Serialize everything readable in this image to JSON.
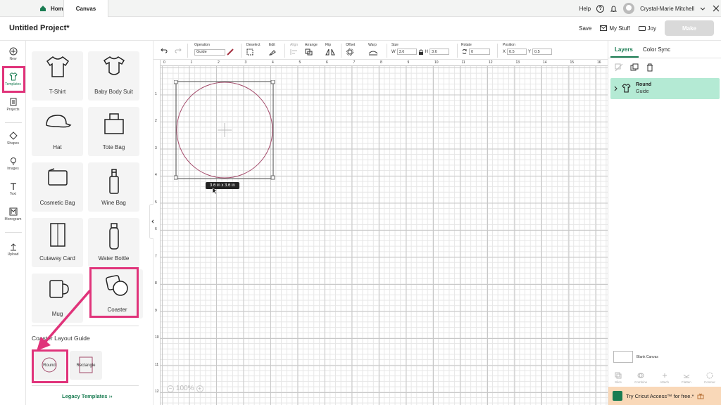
{
  "topbar": {
    "home_label": "Home",
    "canvas_label": "Canvas",
    "help_label": "Help",
    "help_symbol": "?",
    "user_name": "Crystal-Marie Mitchell"
  },
  "project": {
    "title": "Untitled Project*",
    "save_label": "Save",
    "mystuff_label": "My Stuff",
    "joy_label": "Joy",
    "make_label": "Make"
  },
  "leftnav": {
    "new": "New",
    "templates": "Templates",
    "projects": "Projects",
    "shapes": "Shapes",
    "images": "Images",
    "text": "Text",
    "monogram": "Monogram",
    "upload": "Upload"
  },
  "templates": {
    "items": [
      "T-Shirt",
      "Baby Body Suit",
      "Hat",
      "Tote Bag",
      "Cosmetic Bag",
      "Wine Bag",
      "Cutaway Card",
      "Water Bottle",
      "Mug",
      "Coaster"
    ],
    "layout_title": "Coaster Layout Guide",
    "guides": [
      "Round",
      "Rectangle"
    ],
    "legacy_label": "Legacy Templates",
    "legacy_arrow": "››"
  },
  "toolbar": {
    "operation_label": "Operation",
    "operation_value": "Guide",
    "deselect_label": "Deselect",
    "edit_label": "Edit",
    "align_label": "Align",
    "arrange_label": "Arrange",
    "flip_label": "Flip",
    "offset_label": "Offset",
    "warp_label": "Warp",
    "size_label": "Size",
    "w_label": "W",
    "w_value": "3.6",
    "h_label": "H",
    "h_value": "3.6",
    "rotate_label": "Rotate",
    "rotate_value": "0",
    "position_label": "Position",
    "x_label": "X",
    "x_value": "0.5",
    "y_label": "Y",
    "y_value": "0.5"
  },
  "canvas": {
    "ruler_top": [
      "0",
      "1",
      "2",
      "3",
      "4",
      "5",
      "6",
      "7",
      "8",
      "9",
      "10",
      "11",
      "12",
      "13",
      "14",
      "15",
      "16"
    ],
    "ruler_left": [
      "1",
      "2",
      "3",
      "4",
      "5",
      "6",
      "7",
      "8",
      "9",
      "10",
      "11",
      "12"
    ],
    "size_tooltip": "3.6  in x 3.6  in",
    "zoom": "100%"
  },
  "right_panel": {
    "layers_tab": "Layers",
    "colorsync_tab": "Color Sync",
    "layer_name": "Round",
    "layer_sub": "Guide",
    "blank_canvas": "Blank Canvas",
    "tools": [
      "Slice",
      "Combine",
      "Attach",
      "Flatten",
      "Contour"
    ],
    "access_text": "Try Cricut Access™ for free.*"
  },
  "colors": {
    "accent": "#1a7c52",
    "highlight": "#e0337a",
    "selected_layer": "#b4ead4",
    "circle_stroke": "#a34a6a"
  }
}
